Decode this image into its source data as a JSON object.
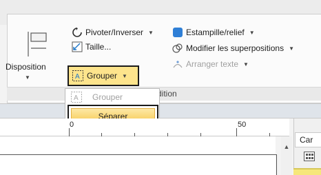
{
  "ribbon": {
    "group_label": "dition",
    "disposition": {
      "label": "Disposition"
    },
    "pivot": {
      "label": "Pivoter/Inverser"
    },
    "taille": {
      "label": "Taille..."
    },
    "grouper": {
      "label": "Grouper"
    },
    "estampille": {
      "label": "Estampille/relief"
    },
    "modifier": {
      "label": "Modifier les superpositions"
    },
    "arranger": {
      "label": "Arranger texte"
    }
  },
  "dropdown": {
    "items": [
      {
        "label": "Grouper",
        "disabled": true
      },
      {
        "label": "Séparer",
        "highlighted": true
      }
    ]
  },
  "ruler": {
    "label_0": "0",
    "label_50": "50"
  },
  "side_panel": {
    "tab_label": "Car"
  },
  "colors": {
    "accent_yellow": "#fde48c",
    "highlight_yellow": "#f6c74f",
    "ribbon_bg": "#fbfbfb"
  },
  "icons": [
    "layout-icon",
    "rotate-icon",
    "resize-icon",
    "group-icon",
    "stamp-icon",
    "overlap-icon",
    "arrange-text-icon",
    "scroll-up-icon",
    "grid-icon"
  ]
}
